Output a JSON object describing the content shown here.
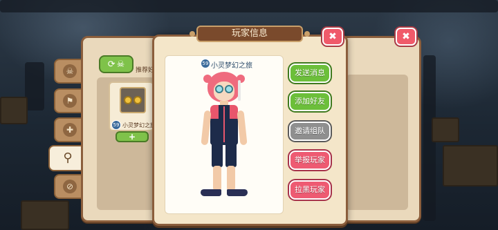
{
  "dialog": {
    "title": "玩家信息",
    "close_symbol": "✖",
    "player": {
      "name": "小灵梦幻之旅",
      "level_badge": "59"
    },
    "actions": [
      {
        "label": "发送消息",
        "style": "green"
      },
      {
        "label": "添加好友",
        "style": "green"
      },
      {
        "label": "邀请组队",
        "style": "gray"
      },
      {
        "label": "举报玩家",
        "style": "red"
      },
      {
        "label": "拉黑玩家",
        "style": "red"
      }
    ]
  },
  "back_panel": {
    "close_symbol": "✖",
    "refresh_icon": "refresh-icon",
    "recommend_label": "推荐好",
    "friend_card": {
      "name": "小灵梦幻之旅",
      "level_badge": "59",
      "add_symbol": "+"
    }
  },
  "side_tabs": [
    {
      "icon": "skull-icon",
      "glyph": "☠",
      "active": false
    },
    {
      "icon": "flag-icon",
      "glyph": "⚑",
      "active": false
    },
    {
      "icon": "add-friend-icon",
      "glyph": "✚",
      "active": false
    },
    {
      "icon": "search-icon",
      "glyph": "⚲",
      "active": true
    },
    {
      "icon": "blocked-icon",
      "glyph": "⊘",
      "active": false
    }
  ],
  "colors": {
    "panel_border": "#8b5e3c",
    "button_green": "#6cbf3a",
    "button_red": "#ee5a72",
    "button_gray": "#8f8f8f",
    "close_red": "#f05a6a"
  }
}
